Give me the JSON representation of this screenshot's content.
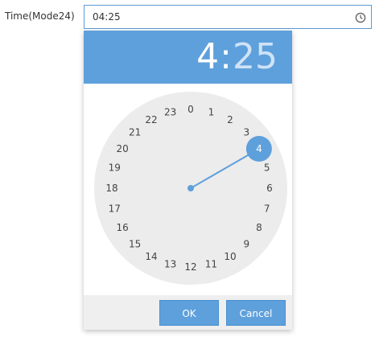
{
  "form": {
    "label": "Time(Mode24)",
    "value": "04:25",
    "clock_icon": "clock-icon"
  },
  "picker": {
    "header": {
      "hours": "4",
      "separator": ":",
      "minutes": "25"
    },
    "dial": {
      "selected_hour": 4,
      "hours": [
        "0",
        "1",
        "2",
        "3",
        "4",
        "5",
        "6",
        "7",
        "8",
        "9",
        "10",
        "11",
        "12",
        "13",
        "14",
        "15",
        "16",
        "17",
        "18",
        "19",
        "20",
        "21",
        "22",
        "23"
      ]
    },
    "buttons": {
      "ok_label": "OK",
      "cancel_label": "Cancel"
    }
  },
  "colors": {
    "accent": "#5ea0dc",
    "dial_face": "#ececec",
    "border_focus": "#5b9bd5"
  }
}
